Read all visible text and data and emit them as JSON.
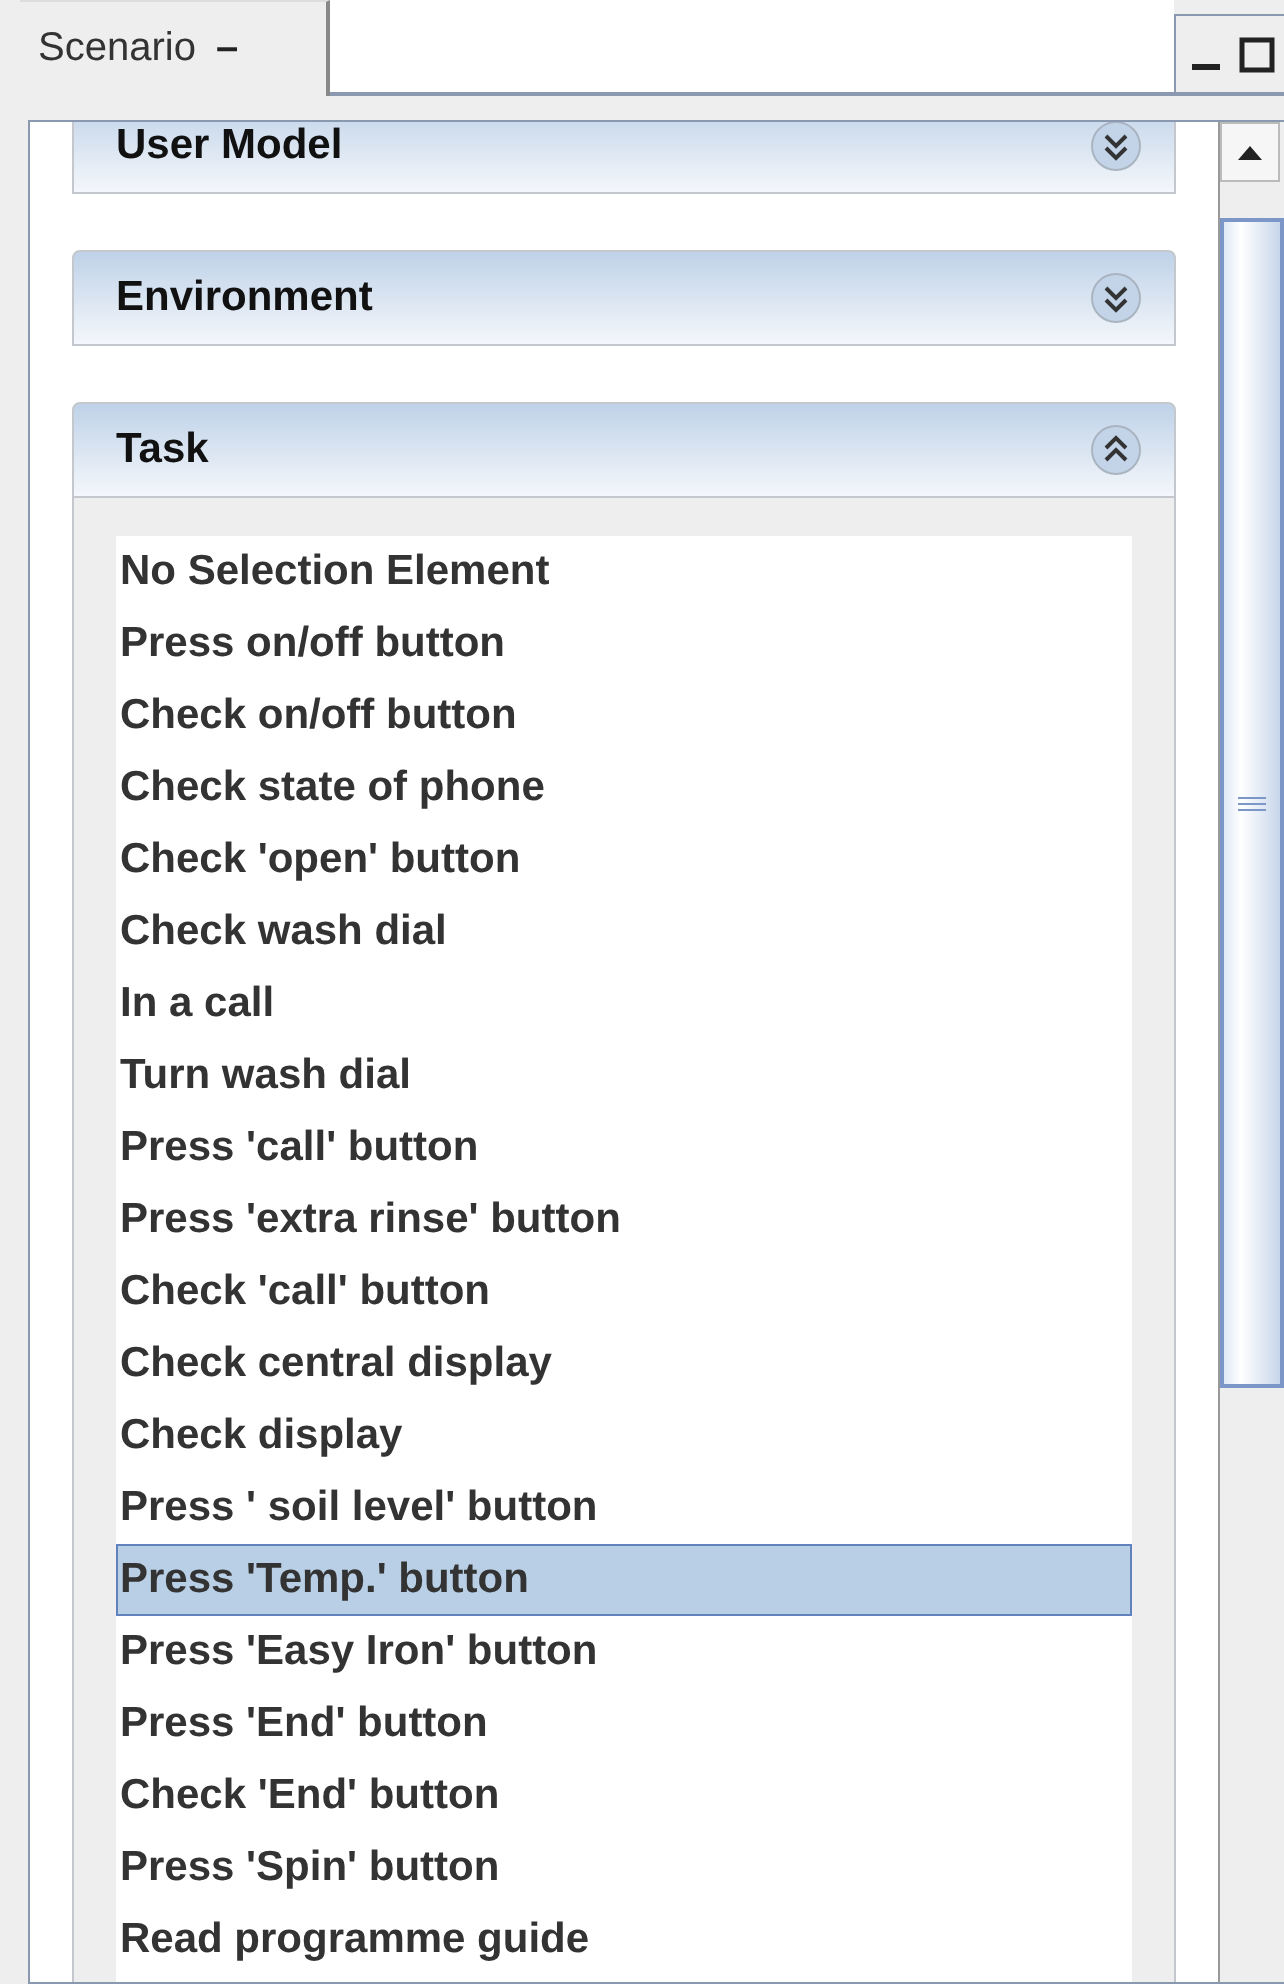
{
  "tab": {
    "title": "Scenario",
    "minimize_glyph": "–"
  },
  "panels": [
    {
      "title": "User Model",
      "expanded": false
    },
    {
      "title": "Environment",
      "expanded": false
    },
    {
      "title": "Task",
      "expanded": true,
      "items": [
        {
          "label": "No Selection Element",
          "selected": false
        },
        {
          "label": "Press on/off button",
          "selected": false
        },
        {
          "label": "Check on/off button",
          "selected": false
        },
        {
          "label": "Check state of phone",
          "selected": false
        },
        {
          "label": "Check 'open' button",
          "selected": false
        },
        {
          "label": "Check wash dial",
          "selected": false
        },
        {
          "label": "In a call",
          "selected": false
        },
        {
          "label": "Turn wash dial",
          "selected": false
        },
        {
          "label": "Press 'call' button",
          "selected": false
        },
        {
          "label": "Press 'extra rinse' button",
          "selected": false
        },
        {
          "label": "Check 'call' button",
          "selected": false
        },
        {
          "label": "Check central display",
          "selected": false
        },
        {
          "label": "Check display",
          "selected": false
        },
        {
          "label": "Press ' soil level' button",
          "selected": false
        },
        {
          "label": "Press 'Temp.' button",
          "selected": true
        },
        {
          "label": "Press 'Easy Iron' button",
          "selected": false
        },
        {
          "label": "Press 'End' button",
          "selected": false
        },
        {
          "label": "Check 'End' button",
          "selected": false
        },
        {
          "label": "Press 'Spin' button",
          "selected": false
        },
        {
          "label": "Read programme guide",
          "selected": false
        }
      ]
    }
  ]
}
